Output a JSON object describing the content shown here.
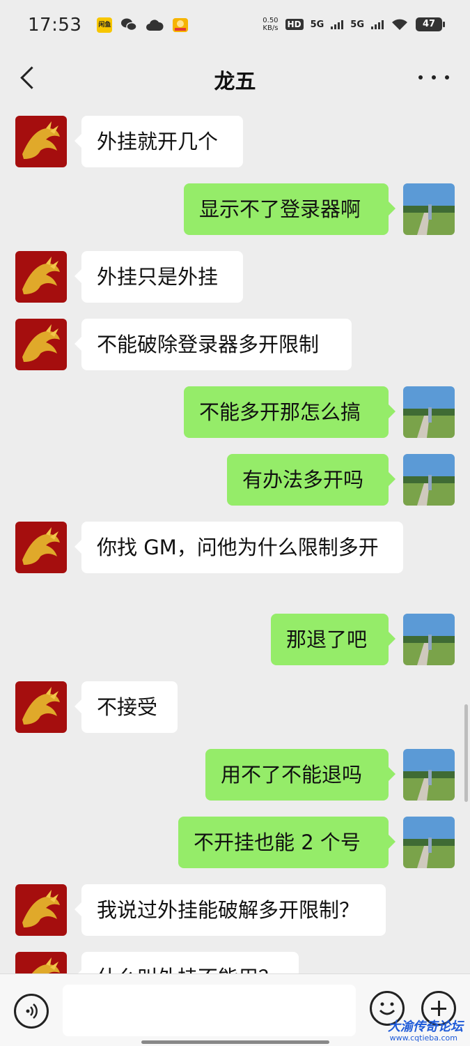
{
  "status_bar": {
    "time": "17:53",
    "net_speed_value": "0.50",
    "net_speed_unit": "KB/s",
    "hd_label": "HD",
    "sim1_label": "5G",
    "sim2_label": "5G",
    "battery_level": "47",
    "app_badge_label": "闲鱼"
  },
  "nav": {
    "title": "龙五"
  },
  "messages": [
    {
      "side": "left",
      "text": "外挂就开几个"
    },
    {
      "side": "right",
      "text": "显示不了登录器啊"
    },
    {
      "side": "left",
      "text": "外挂只是外挂"
    },
    {
      "side": "left",
      "text": "不能破除登录器多开限制"
    },
    {
      "side": "right",
      "text": "不能多开那怎么搞"
    },
    {
      "side": "right",
      "text": "有办法多开吗"
    },
    {
      "side": "left",
      "text": "你找 GM，问他为什么限制多开"
    },
    {
      "side": "right",
      "text": "那退了吧"
    },
    {
      "side": "left",
      "text": "不接受"
    },
    {
      "side": "right",
      "text": "用不了不能退吗"
    },
    {
      "side": "right",
      "text": "不开挂也能 2 个号"
    },
    {
      "side": "left",
      "text": "我说过外挂能破解多开限制？"
    },
    {
      "side": "left",
      "text": "什么叫外挂不能用？"
    }
  ],
  "input_bar": {
    "placeholder": ""
  },
  "watermark": {
    "text": "大渝传奇论坛",
    "url": "www.cqtieba.com"
  },
  "colors": {
    "background": "#ededed",
    "sent_bubble": "#95ec69",
    "received_bubble": "#ffffff"
  }
}
